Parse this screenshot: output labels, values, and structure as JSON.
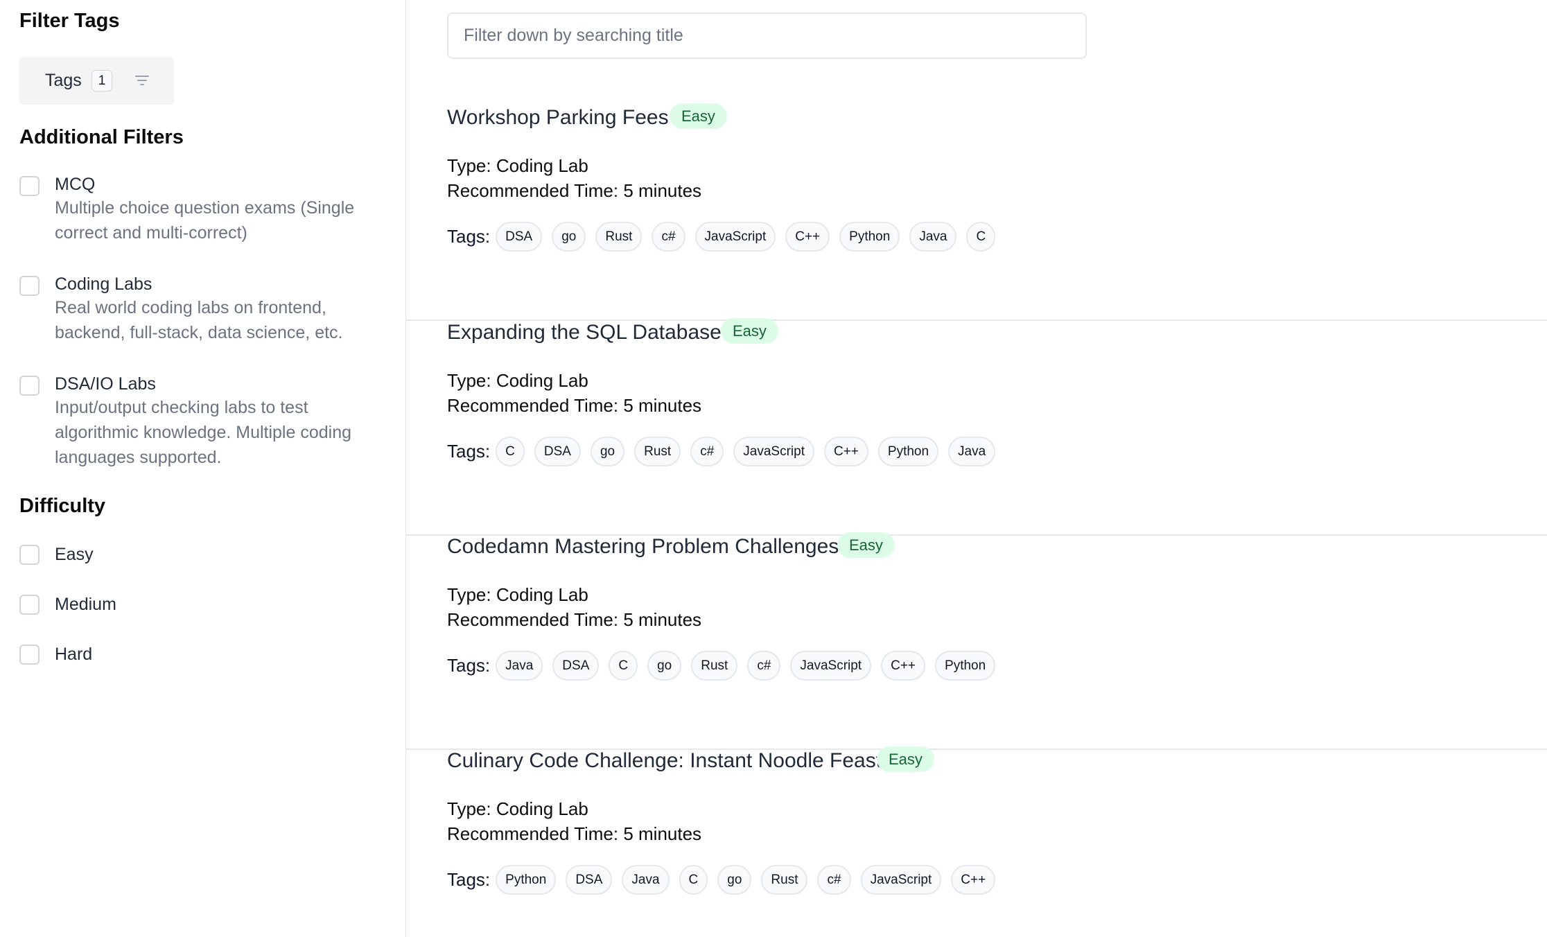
{
  "sidebar": {
    "filter_tags_heading": "Filter Tags",
    "tags_button": {
      "label": "Tags",
      "count": "1"
    },
    "additional_filters_heading": "Additional Filters",
    "additional_filters": [
      {
        "title": "MCQ",
        "description": "Multiple choice question exams (Single correct and multi-correct)"
      },
      {
        "title": "Coding Labs",
        "description": "Real world coding labs on frontend, backend, full-stack, data science, etc."
      },
      {
        "title": "DSA/IO Labs",
        "description": "Input/output checking labs to test algorithmic knowledge. Multiple coding languages supported."
      }
    ],
    "difficulty_heading": "Difficulty",
    "difficulty": [
      "Easy",
      "Medium",
      "Hard"
    ]
  },
  "search": {
    "placeholder": "Filter down by searching title"
  },
  "labs": [
    {
      "title": "Workshop Parking Fees",
      "difficulty": "Easy",
      "type": "Type: Coding Lab",
      "time": "Recommended Time: 5 minutes",
      "tags_label": "Tags:",
      "tags": [
        "DSA",
        "go",
        "Rust",
        "c#",
        "JavaScript",
        "C++",
        "Python",
        "Java",
        "C"
      ]
    },
    {
      "title": "Expanding the SQL Database",
      "difficulty": "Easy",
      "type": "Type: Coding Lab",
      "time": "Recommended Time: 5 minutes",
      "tags_label": "Tags:",
      "tags": [
        "C",
        "DSA",
        "go",
        "Rust",
        "c#",
        "JavaScript",
        "C++",
        "Python",
        "Java"
      ]
    },
    {
      "title": "Codedamn Mastering Problem Challenges",
      "difficulty": "Easy",
      "type": "Type: Coding Lab",
      "time": "Recommended Time: 5 minutes",
      "tags_label": "Tags:",
      "tags": [
        "Java",
        "DSA",
        "C",
        "go",
        "Rust",
        "c#",
        "JavaScript",
        "C++",
        "Python"
      ]
    },
    {
      "title": "Culinary Code Challenge: Instant Noodle Feast",
      "difficulty": "Easy",
      "type": "Type: Coding Lab",
      "time": "Recommended Time: 5 minutes",
      "tags_label": "Tags:",
      "tags": [
        "Python",
        "DSA",
        "Java",
        "C",
        "go",
        "Rust",
        "c#",
        "JavaScript",
        "C++"
      ]
    }
  ]
}
